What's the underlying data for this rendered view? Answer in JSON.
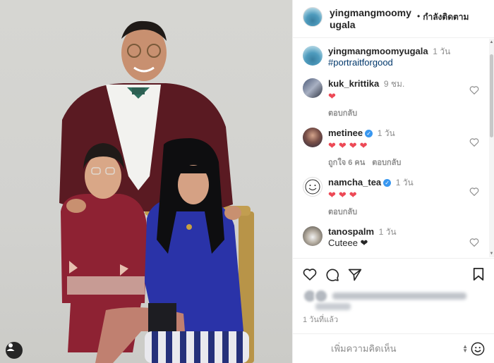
{
  "post": {
    "username": "yingmangmoomyugala",
    "follow_status": "กำลังติดตาม",
    "caption": {
      "username": "yingmangmoomyugala",
      "time": "1 วัน",
      "text": "#portraitforgood"
    },
    "comments": [
      {
        "username": "kuk_krittika",
        "time": "9 ชม.",
        "text": "❤",
        "reply": "ตอบกลับ",
        "likes": ""
      },
      {
        "username": "metinee",
        "verified": true,
        "time": "1 วัน",
        "text": "❤❤❤❤",
        "likes": "ถูกใจ 6 คน",
        "reply": "ตอบกลับ"
      },
      {
        "username": "namcha_tea",
        "verified": true,
        "time": "1 วัน",
        "text": "❤❤❤",
        "reply": "ตอบกลับ",
        "likes": ""
      },
      {
        "username": "tanospalm",
        "time": "1 วัน",
        "text": "Cuteee ❤",
        "reply": "",
        "likes": ""
      }
    ],
    "posted_time": "1 วันที่แล้ว",
    "add_comment_placeholder": "เพิ่มความคิดเห็น"
  },
  "icons": {
    "like": "heart-icon",
    "comment": "comment-icon",
    "share": "share-icon",
    "save": "bookmark-icon",
    "more": "more-icon",
    "emoji": "emoji-icon",
    "user_tag": "user-tag-icon"
  },
  "colors": {
    "heart_red": "#ed4956",
    "link_blue": "#00376b",
    "verified_blue": "#3897f0",
    "secondary_text": "#8e8e8e"
  }
}
